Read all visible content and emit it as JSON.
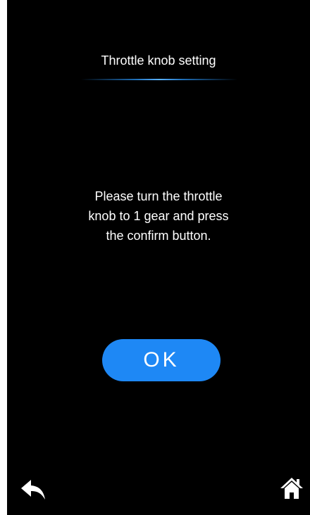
{
  "header": {
    "title": "Throttle knob setting"
  },
  "main": {
    "message_line1": "Please turn the throttle",
    "message_line2": "knob to 1 gear and press",
    "message_line3": "the confirm button."
  },
  "actions": {
    "ok_label": "OK"
  },
  "footer": {
    "back_icon": "back-arrow-icon",
    "home_icon": "home-icon"
  },
  "colors": {
    "background": "#000000",
    "accent": "#1e88f5",
    "text": "#ffffff"
  }
}
